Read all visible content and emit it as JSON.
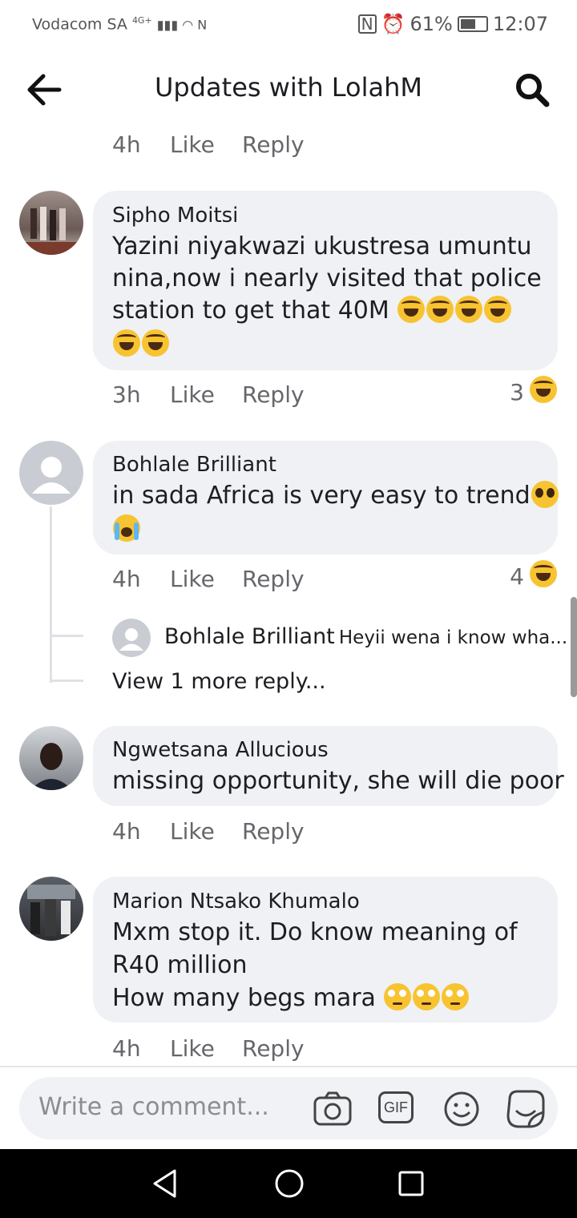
{
  "status_bar": {
    "carrier": "Vodacom SA",
    "network": "4G+",
    "battery": "61%",
    "time": "12:07"
  },
  "header": {
    "title": "Updates with LolahM",
    "back_icon": "arrow-left-icon",
    "search_icon": "search-icon"
  },
  "top_meta": {
    "time": "4h",
    "like": "Like",
    "reply": "Reply"
  },
  "comments": [
    {
      "name": "Sipho Moitsi",
      "text_line1": "Yazini niyakwazi ukustresa umuntu",
      "text_line2": "nina,now i nearly visited that police",
      "text_line3": "station to get that 40M",
      "time": "3h",
      "like": "Like",
      "reply": "Reply",
      "reaction_count": "3"
    },
    {
      "name": "Bohlale Brilliant",
      "text_line1": "in sada Africa is very easy to trend",
      "time": "4h",
      "like": "Like",
      "reply": "Reply",
      "reaction_count": "4",
      "reply_preview_name": "Bohlale Brilliant",
      "reply_preview_text": "Heyii wena i know wha...",
      "view_more": "View 1 more reply..."
    },
    {
      "name": "Ngwetsana Allucious",
      "text_line1": "missing opportunity, she will die poor",
      "time": "4h",
      "like": "Like",
      "reply": "Reply"
    },
    {
      "name": "Marion Ntsako Khumalo",
      "text_line1": "Mxm stop it. Do know meaning of",
      "text_line2": "R40 million",
      "text_line3": "How many begs mara",
      "time": "4h",
      "like": "Like",
      "reply": "Reply"
    }
  ],
  "composer": {
    "placeholder": "Write a comment...",
    "gif_label": "GIF"
  },
  "colors": {
    "bubble": "#eff1f4",
    "meta": "#65676b",
    "reaction": "#f7c331"
  }
}
